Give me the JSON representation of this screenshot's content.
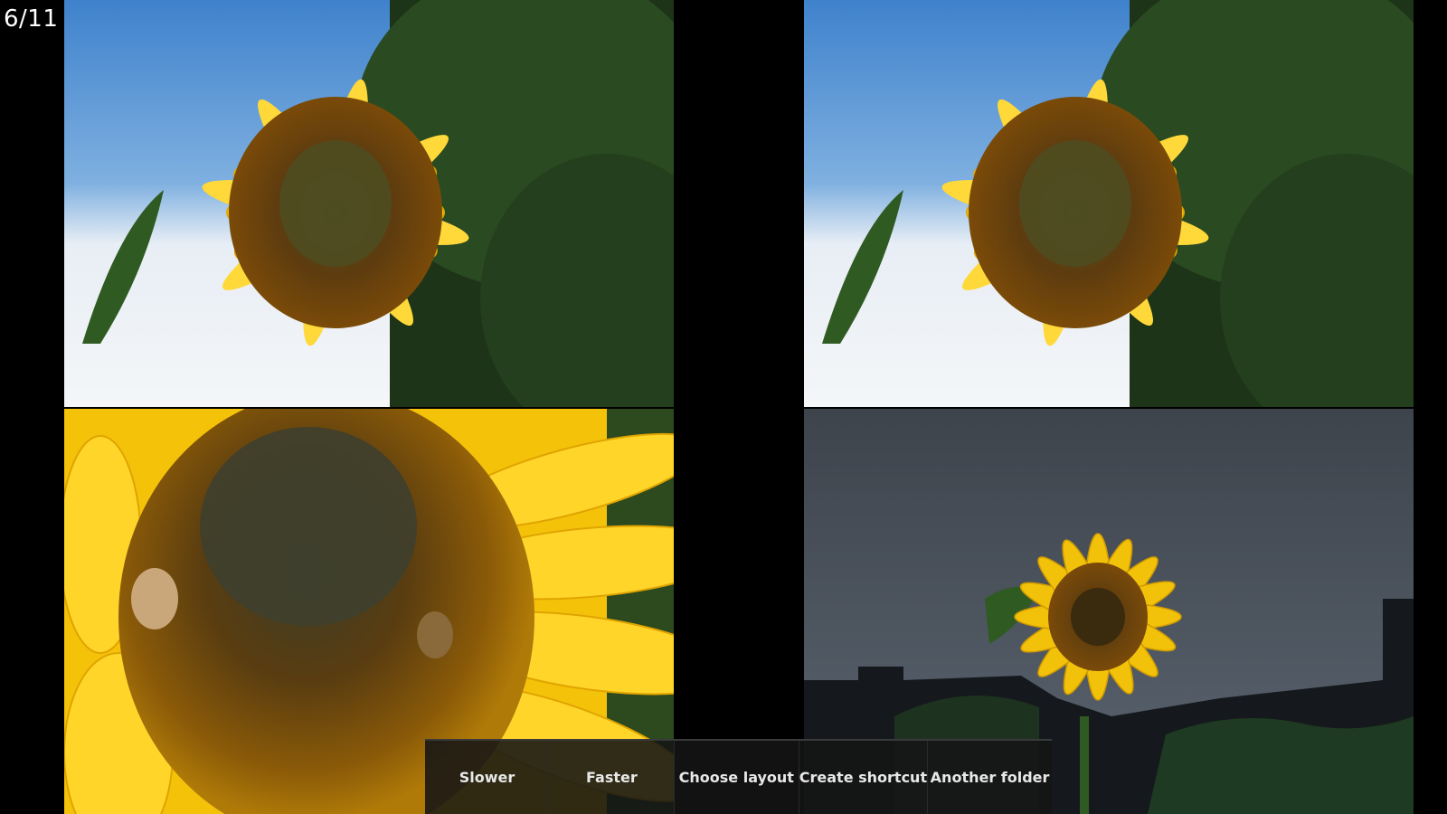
{
  "viewer": {
    "counter": "6/11"
  },
  "menu": {
    "items": [
      {
        "label": "Slower"
      },
      {
        "label": "Faster"
      },
      {
        "label": "Choose layout"
      },
      {
        "label": "Create shortcut"
      },
      {
        "label": "Another folder"
      }
    ]
  },
  "colors": {
    "background": "#000000",
    "petal": "#f7c90d",
    "seed_center": "#5a3a10",
    "sky": "#4a86c8",
    "foliage": "#1f3a1a",
    "storm_sky": "#4a525c"
  }
}
